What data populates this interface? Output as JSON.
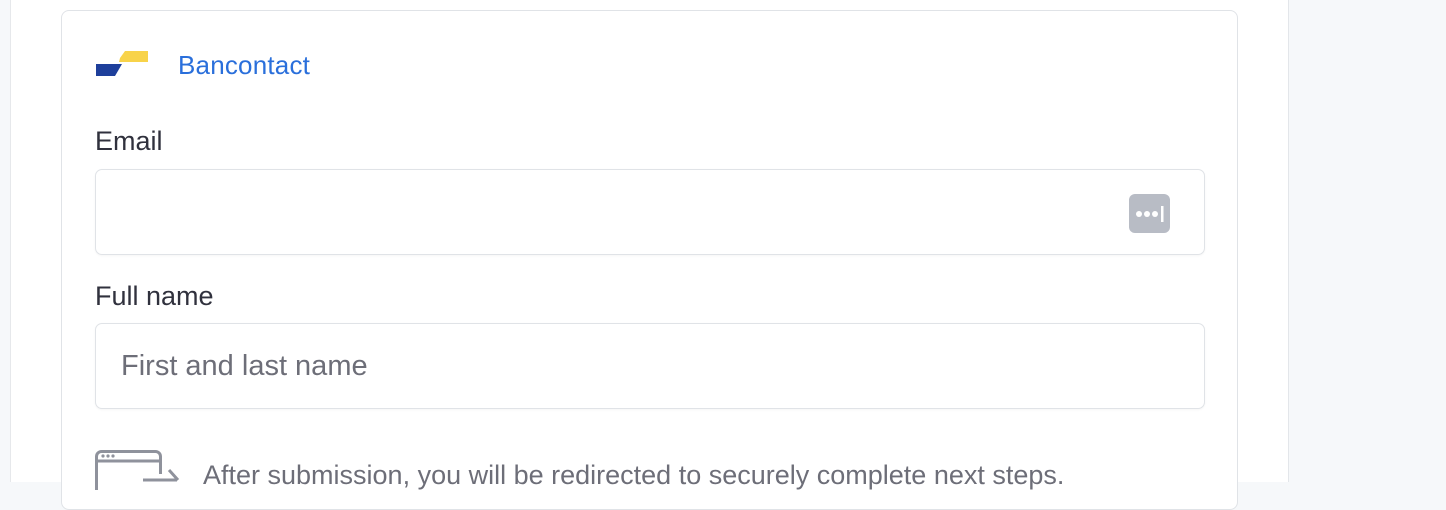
{
  "payment_method": {
    "name": "Bancontact",
    "logo_colors": {
      "blue": "#1e3f9b",
      "yellow": "#f8d34a"
    },
    "accent_color": "#2a6fdb"
  },
  "email": {
    "label": "Email",
    "value": "",
    "autofill_icon": "password-manager-icon"
  },
  "full_name": {
    "label": "Full name",
    "placeholder": "First and last name",
    "value": ""
  },
  "redirect": {
    "icon": "redirect-window-icon",
    "text": "After submission, you will be redirected to securely complete next steps."
  }
}
